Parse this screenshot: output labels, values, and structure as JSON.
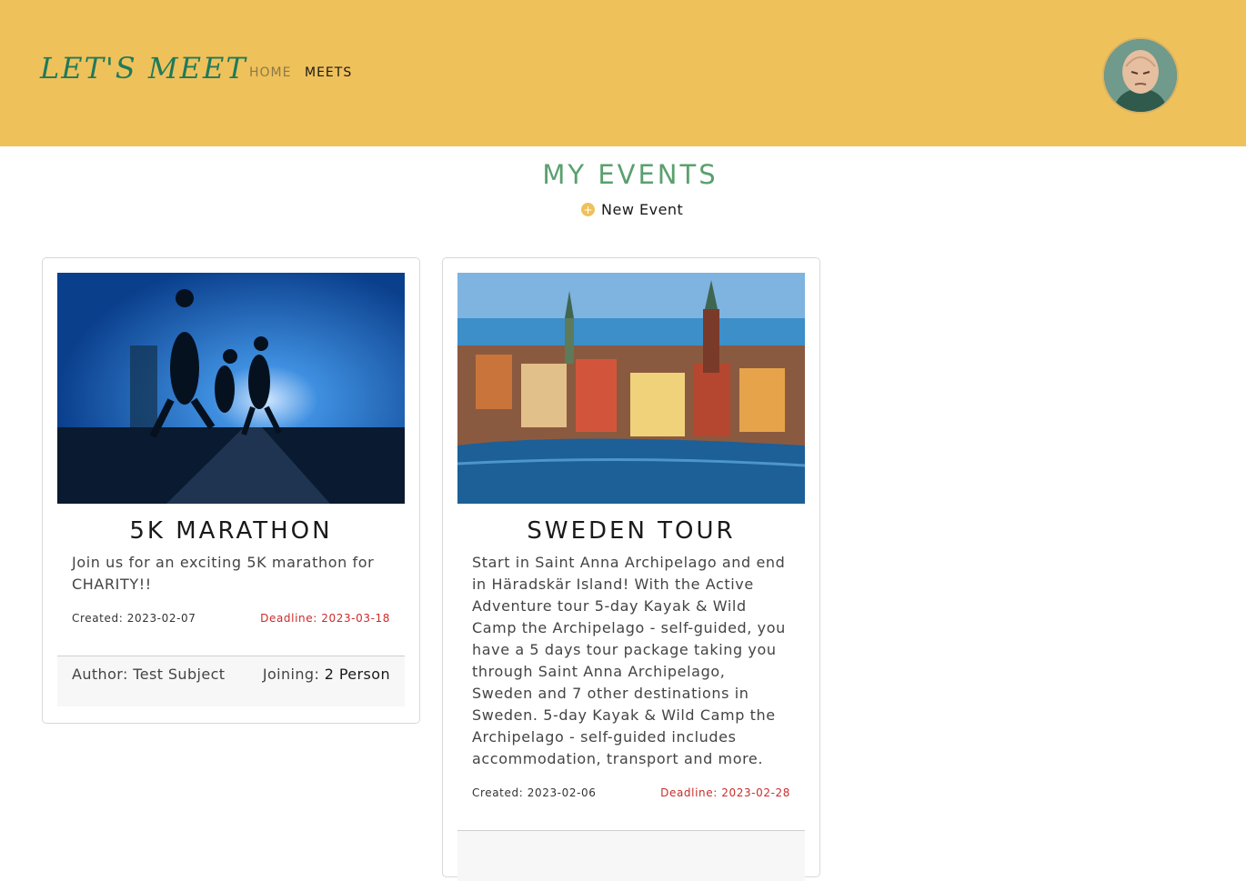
{
  "header": {
    "logo": "LET'S MEET",
    "nav": {
      "home": "HOME",
      "meets": "MEETS"
    }
  },
  "page": {
    "title": "MY EVENTS",
    "new_event_label": "New Event"
  },
  "events": [
    {
      "title": "5K MARATHON",
      "description": "Join us for an exciting 5K marathon for CHARITY!!",
      "created": "Created: 2023-02-07",
      "deadline": "Deadline: 2023-03-18",
      "author": "Author: Test Subject",
      "joining_label": "Joining:",
      "joining_value": "2 Person"
    },
    {
      "title": "SWEDEN TOUR",
      "description": "Start in Saint Anna Archipelago and end in Häradskär Island! With the Active Adventure tour 5-day Kayak & Wild Camp the Archipelago - self-guided, you have a 5 days tour package taking you through Saint Anna Archipelago, Sweden and 7 other destinations in Sweden. 5-day Kayak & Wild Camp the Archipelago - self-guided includes accommodation, transport and more.",
      "created": "Created: 2023-02-06",
      "deadline": "Deadline: 2023-02-28"
    }
  ],
  "colors": {
    "header_bg": "#efc15b",
    "title": "#5aa06e",
    "logo": "#1f7a5a",
    "deadline": "#cc2b2b"
  }
}
